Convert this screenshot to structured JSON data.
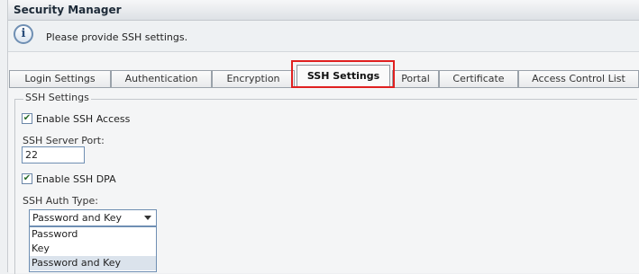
{
  "window": {
    "title": "Security Manager"
  },
  "info": {
    "icon": "info-icon",
    "message": "Please provide SSH settings."
  },
  "tabs": [
    {
      "label": "Login Settings"
    },
    {
      "label": "Authentication"
    },
    {
      "label": "Encryption"
    },
    {
      "label": "SSH Settings"
    },
    {
      "label": "Portal"
    },
    {
      "label": "Certificate"
    },
    {
      "label": "Access Control List"
    }
  ],
  "active_tab": "SSH Settings",
  "highlight_color": "#e02020",
  "ssh": {
    "legend": "SSH Settings",
    "enable_access": {
      "label": "Enable SSH Access",
      "checked": true
    },
    "port": {
      "label": "SSH Server Port:",
      "value": "22"
    },
    "enable_dpa": {
      "label": "Enable SSH DPA",
      "checked": true
    },
    "auth_type": {
      "label": "SSH Auth Type:",
      "selected": "Password and Key",
      "options": [
        "Password",
        "Key",
        "Password and Key"
      ]
    }
  }
}
